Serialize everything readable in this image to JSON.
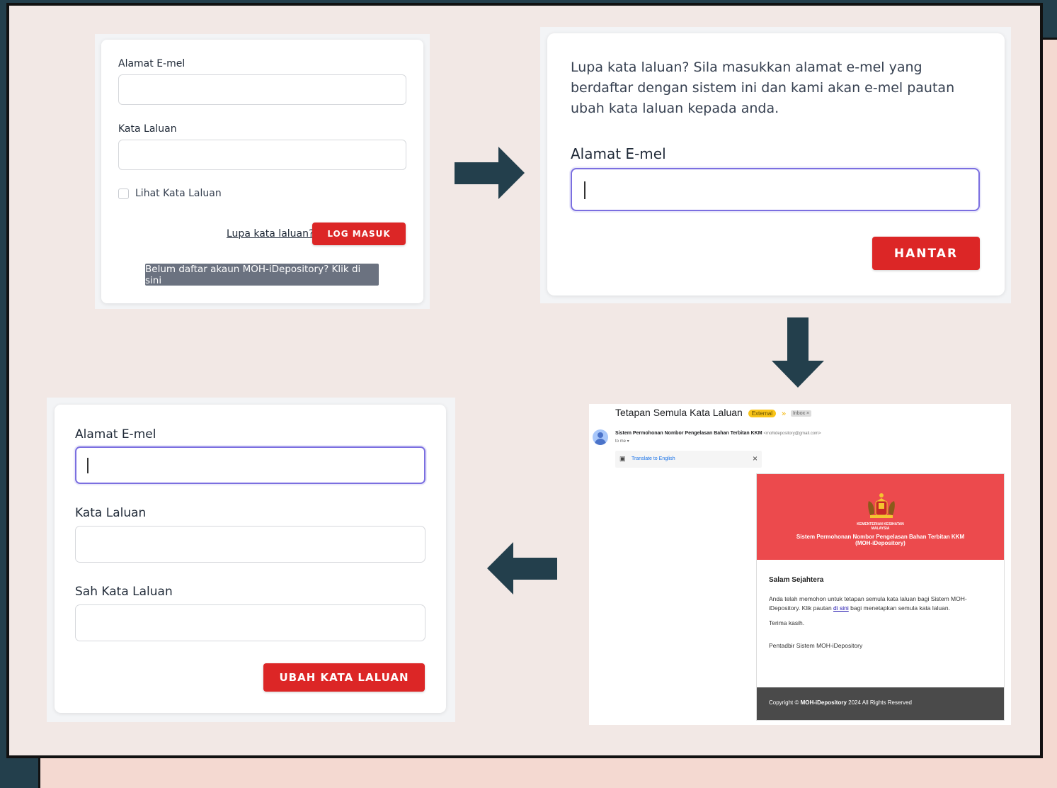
{
  "colors": {
    "accent": "#dc2626",
    "dark": "#233f4c",
    "frame": "#f2e8e5",
    "email_header": "#ec4a4d"
  },
  "login": {
    "email_label": "Alamat E-mel",
    "password_label": "Kata Laluan",
    "show_password_label": "Lihat Kata Laluan",
    "forgot_link": "Lupa kata laluan?",
    "login_button": "LOG MASUK",
    "register_button": "Belum daftar akaun MOH-iDepository? Klik di sini"
  },
  "forgot": {
    "intro": "Lupa kata laluan? Sila masukkan alamat e-mel yang berdaftar dengan sistem ini dan kami akan e-mel pautan ubah kata laluan kepada anda.",
    "email_label": "Alamat E-mel",
    "submit_button": "HANTAR"
  },
  "email": {
    "subject": "Tetapan Semula Kata Laluan",
    "external_badge": "External",
    "inbox_badge": "Inbox ×",
    "sender_name": "Sistem Permohonan Nombor Pengelasan Bahan Terbitan KKM",
    "sender_address": "<mohidepository@gmail.com>",
    "to_me": "to me ▾",
    "translate": "Translate to English",
    "ministry_line1": "KEMENTERIAN KESIHATAN",
    "ministry_line2": "MALAYSIA",
    "header_title_1": "Sistem Permohonan Nombor Pengelasan Bahan Terbitan KKM",
    "header_title_2": "(MOH-iDepository)",
    "greeting": "Salam Sejahtera",
    "body_1": "Anda telah memohon untuk tetapan semula kata laluan bagi Sistem MOH-",
    "body_2a": "iDepository. Klik pautan ",
    "link_text": "di sini",
    "body_2b": " bagi menetapkan semula kata laluan.",
    "thanks": "Terima kasih.",
    "signoff": "Pentadbir Sistem MOH-iDepository",
    "footer_prefix": "Copyright © ",
    "footer_brand": "MOH-iDepository",
    "footer_suffix": " 2024 All Rights Reserved"
  },
  "reset": {
    "email_label": "Alamat E-mel",
    "password_label": "Kata Laluan",
    "confirm_label": "Sah Kata Laluan",
    "submit_button": "UBAH KATA LALUAN"
  },
  "icons": [
    "arrow-right-icon",
    "arrow-down-icon",
    "arrow-left-icon",
    "avatar-icon",
    "translate-icon",
    "close-icon",
    "malaysia-crest-icon",
    "chevron-double-icon"
  ]
}
